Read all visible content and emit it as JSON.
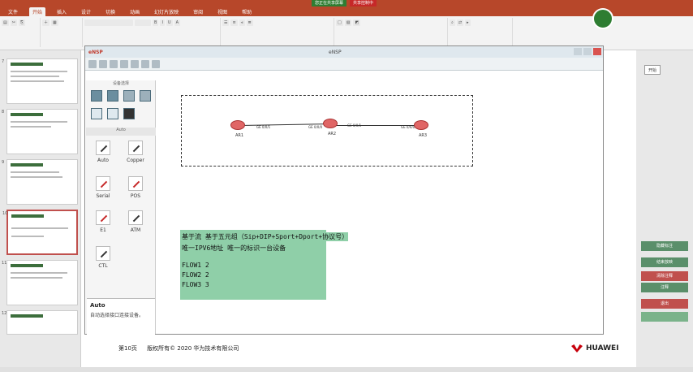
{
  "ribbon": {
    "tabs": [
      "文件",
      "开始",
      "插入",
      "设计",
      "切换",
      "动画",
      "幻灯片放映",
      "审阅",
      "视图",
      "帮助"
    ],
    "active_tab": "开始",
    "share_banner": [
      "您正在共享屏幕",
      "共享控制中"
    ]
  },
  "ensp": {
    "app_name": "eNSP",
    "window_title": "eNSP",
    "panel_header": "设备选择",
    "pane_sub_header": "Auto",
    "cables": [
      {
        "label": "Auto",
        "color": "#333333"
      },
      {
        "label": "Copper",
        "color": "#333333"
      },
      {
        "label": "Serial",
        "color": "#c62828"
      },
      {
        "label": "POS",
        "color": "#c62828"
      },
      {
        "label": "E1",
        "color": "#c62828"
      },
      {
        "label": "ATM",
        "color": "#333333"
      },
      {
        "label": "CTL",
        "color": "#333333"
      }
    ],
    "description_title": "Auto",
    "description_text": "自动选择接口连接设备。"
  },
  "topology": {
    "routers": [
      "AR1",
      "AR2",
      "AR3"
    ],
    "ports": [
      "GE 0/0/1",
      "GE 0/0/0",
      "GE 0/0/1",
      "GE 0/0/0"
    ]
  },
  "note": {
    "heading": "基于流   基于五元组（Sip+DIP+Sport+Dport+协议号）",
    "line2": "唯一IPV6地址 唯一的标识一台设备",
    "flows": [
      "FLOW1  2",
      "FLOW2  2",
      "FLOW3  3"
    ]
  },
  "footer": {
    "page": "第10页",
    "copyright": "版权所有© 2020 华为技术有限公司",
    "brand": "HUAWEI"
  },
  "right_bar": {
    "items": [
      "开始",
      "隐藏标注",
      "结束放映",
      "清除注释",
      "注释",
      "退出"
    ]
  },
  "slide_numbers": [
    "7",
    "8",
    "9",
    "10",
    "11",
    "12"
  ]
}
